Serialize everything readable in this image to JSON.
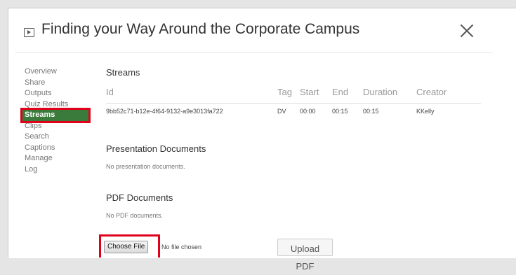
{
  "dialog": {
    "title": "Finding your Way Around the Corporate Campus",
    "icon": "play-icon",
    "close_icon": "close-icon"
  },
  "nav": {
    "items": [
      {
        "label": "Overview"
      },
      {
        "label": "Share"
      },
      {
        "label": "Outputs"
      },
      {
        "label": "Quiz Results"
      },
      {
        "label": "Streams",
        "active": true
      },
      {
        "label": "Clips"
      },
      {
        "label": "Search"
      },
      {
        "label": "Captions"
      },
      {
        "label": "Manage"
      },
      {
        "label": "Log"
      }
    ]
  },
  "streams": {
    "title": "Streams",
    "columns": [
      "Id",
      "Tag",
      "Start",
      "End",
      "Duration",
      "Creator"
    ],
    "rows": [
      [
        "9bb52c71-b12e-4f64-9132-a9e3013fa722",
        "DV",
        "00:00",
        "00:15",
        "00:15",
        "KKelly"
      ]
    ]
  },
  "presentation": {
    "title": "Presentation Documents",
    "empty_text": "No presentation documents."
  },
  "pdf": {
    "title": "PDF Documents",
    "empty_text": "No PDF documents.",
    "choose_label": "Choose File",
    "no_file_text": "No file chosen",
    "upload_label": "Upload PDF"
  },
  "colors": {
    "accent_green": "#3a7a3a",
    "highlight_red": "#e0001b"
  }
}
